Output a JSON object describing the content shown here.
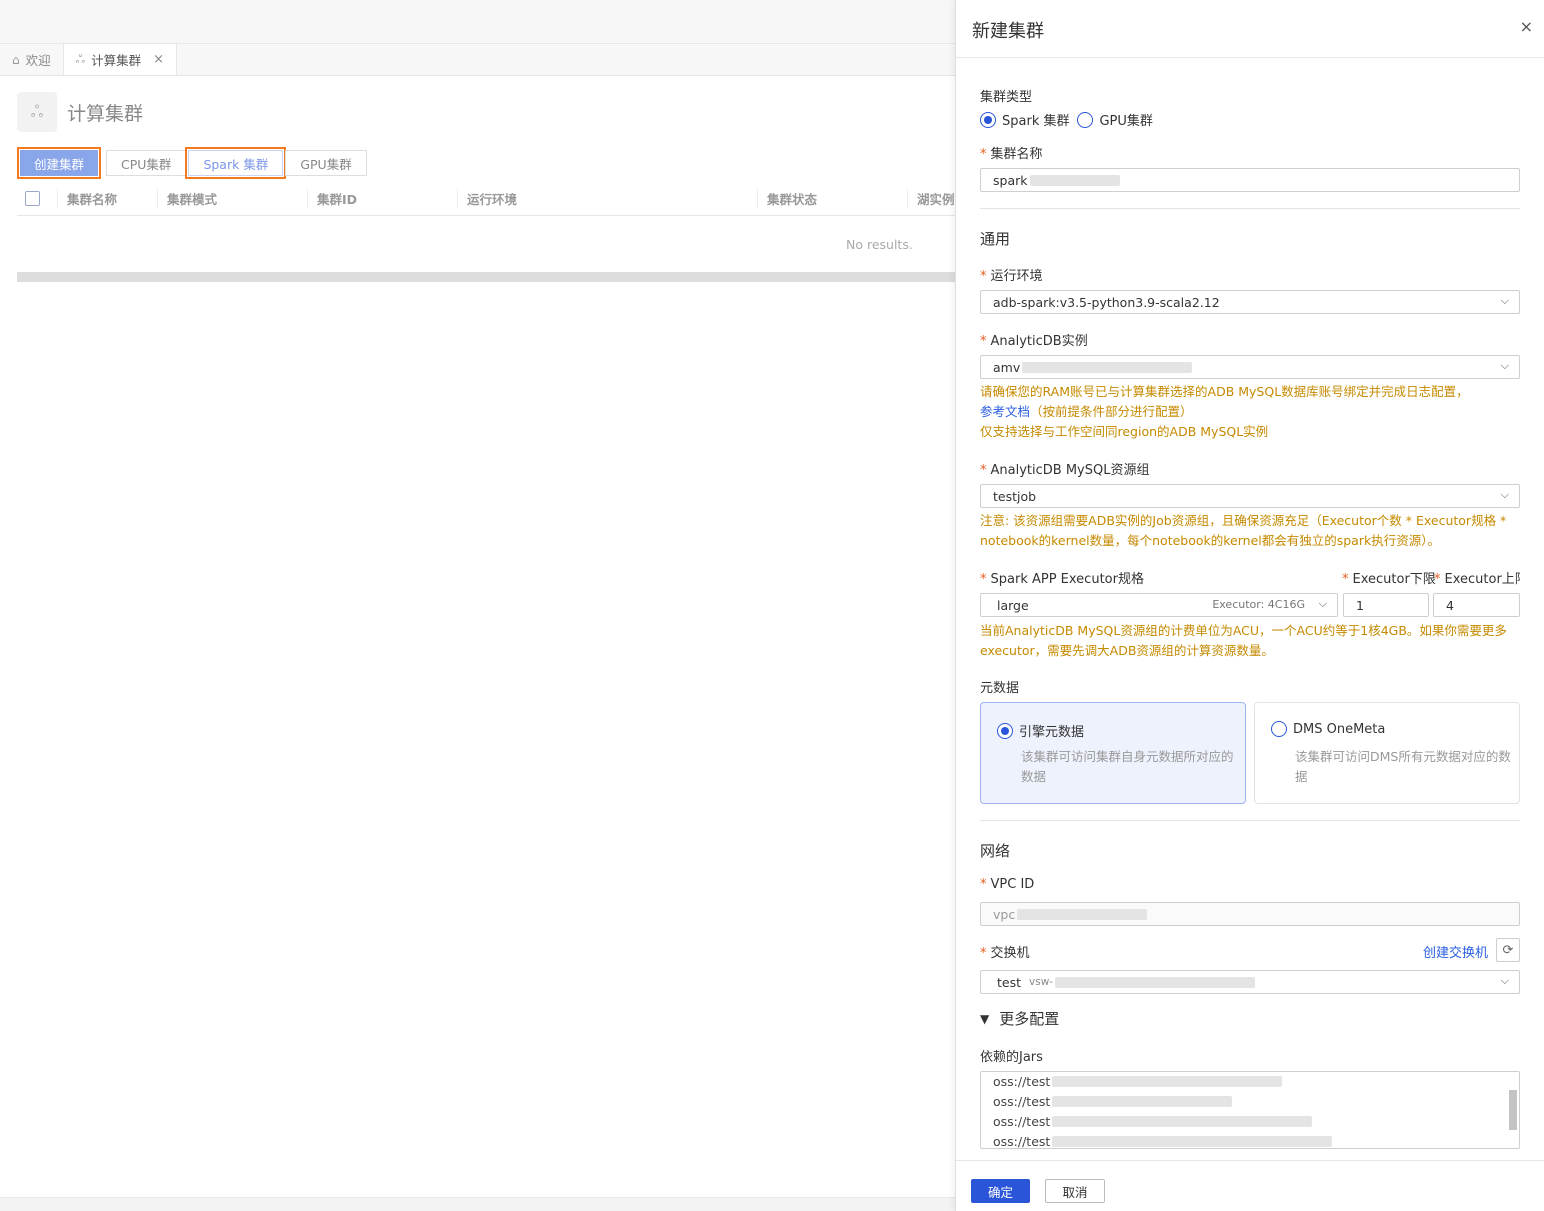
{
  "tabs": [
    {
      "icon": "home-icon",
      "label": "欢迎"
    },
    {
      "icon": "cluster-icon",
      "label": "计算集群"
    }
  ],
  "page": {
    "title": "计算集群",
    "create_button": "创建集群",
    "filters": [
      "CPU集群",
      "Spark 集群",
      "GPU集群"
    ],
    "columns": [
      "集群名称",
      "集群模式",
      "集群ID",
      "运行环境",
      "集群状态",
      "湖实例"
    ],
    "empty": "No results."
  },
  "drawer": {
    "title": "新建集群",
    "close": "×",
    "cluster_type": {
      "label": "集群类型",
      "options": [
        "Spark 集群",
        "GPU集群"
      ],
      "selected": "Spark 集群"
    },
    "cluster_name": {
      "label": "集群名称",
      "value": "spark"
    },
    "general": {
      "title": "通用",
      "runtime": {
        "label": "运行环境",
        "value": "adb-spark:v3.5-python3.9-scala2.12"
      },
      "instance": {
        "label": "AnalyticDB实例",
        "value": "amv",
        "warn1": "请确保您的RAM账号已与计算集群选择的ADB MySQL数据库账号绑定并完成日志配置，",
        "doc_link": "参考文档",
        "warn2": "（按前提条件部分进行配置）",
        "warn3": "仅支持选择与工作空间同region的ADB MySQL实例"
      },
      "resource_group": {
        "label": "AnalyticDB MySQL资源组",
        "value": "testjob",
        "warn1": "注意: 该资源组需要ADB实例的Job资源组，且确保资源充足（Executor个数 * Executor规格 *",
        "warn2": "notebook的kernel数量，每个notebook的kernel都会有独立的spark执行资源）。"
      },
      "executor": {
        "spec_label": "Spark APP Executor规格",
        "spec_value": "large",
        "spec_hint": "Executor: 4C16G",
        "min_label": "Executor下限",
        "min_value": "1",
        "max_label": "Executor上限",
        "max_value": "4",
        "warn1": "当前AnalyticDB MySQL资源组的计费单位为ACU，一个ACU约等于1核4GB。如果你需要更多",
        "warn2": "executor，需要先调大ADB资源组的计算资源数量。"
      },
      "metadata": {
        "label": "元数据",
        "options": [
          {
            "title": "引擎元数据",
            "desc": "该集群可访问集群自身元数据所对应的数据",
            "selected": true
          },
          {
            "title": "DMS OneMeta",
            "desc": "该集群可访问DMS所有元数据对应的数据",
            "selected": false
          }
        ]
      }
    },
    "network": {
      "title": "网络",
      "vpc": {
        "label": "VPC ID",
        "value": "vpc"
      },
      "vswitch": {
        "label": "交换机",
        "create_link": "创建交换机",
        "value": "test",
        "hint": "vsw-"
      }
    },
    "more": {
      "title": "更多配置",
      "jars": {
        "label": "依赖的Jars",
        "lines": [
          "oss://test",
          "oss://test",
          "oss://test",
          "oss://test"
        ]
      }
    },
    "footer": {
      "ok": "确定",
      "cancel": "取消"
    }
  }
}
